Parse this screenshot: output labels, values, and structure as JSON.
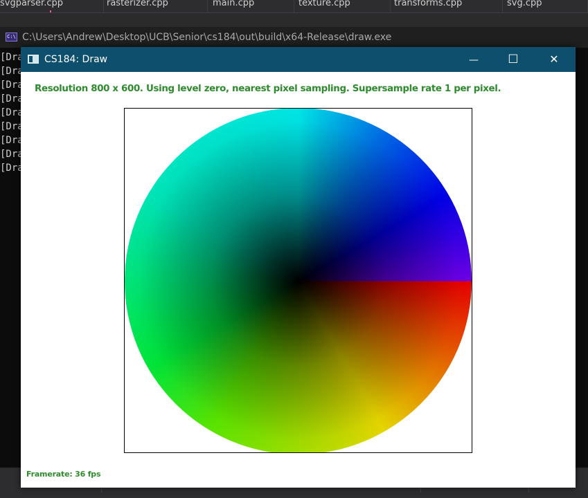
{
  "editor_tabs": [
    {
      "label": "svgparser.cpp"
    },
    {
      "label": "rasterizer.cpp"
    },
    {
      "label": "main.cpp"
    },
    {
      "label": "texture.cpp"
    },
    {
      "label": "transforms.cpp"
    },
    {
      "label": "svg.cpp"
    }
  ],
  "console": {
    "icon_text": "C:\\",
    "title": "C:\\Users\\Andrew\\Desktop\\UCB\\Senior\\cs184\\out\\build\\x64-Release\\draw.exe",
    "lines": [
      "[Dra",
      "[Dra",
      "[Dra",
      "[Dra",
      "[Dra",
      "[Dra",
      "[Dra",
      "[Dra",
      "[Dra"
    ]
  },
  "draw_window": {
    "title": "CS184: Draw",
    "minimize_glyph": "—",
    "maximize_glyph": "☐",
    "close_glyph": "✕",
    "status": "Resolution 800 x 600. Using level zero, nearest pixel sampling. Supersample rate 1 per pixel.",
    "framerate": "Framerate: 36 fps"
  },
  "colors": {
    "titlebar": "#0e4f6e",
    "status_text": "#2e8b2e",
    "console_bg": "#0c0c0c"
  },
  "icons": {
    "window_icon": "app-window-icon",
    "console_icon": "console-app-icon"
  }
}
